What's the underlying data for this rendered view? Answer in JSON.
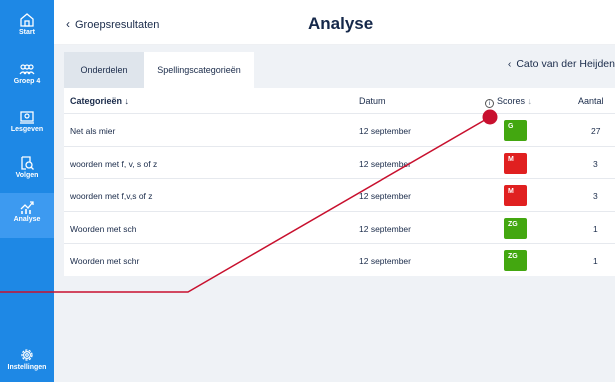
{
  "sidebar": {
    "items": [
      {
        "label": "Start",
        "icon": "home-icon"
      },
      {
        "label": "Groep 4",
        "icon": "group-icon"
      },
      {
        "label": "Lesgeven",
        "icon": "teach-icon"
      },
      {
        "label": "Volgen",
        "icon": "follow-icon"
      },
      {
        "label": "Analyse",
        "icon": "analysis-icon"
      },
      {
        "label": "Instellingen",
        "icon": "gear-icon"
      }
    ],
    "active": "Analyse"
  },
  "header": {
    "back_label": "Groepsresultaten",
    "title": "Analyse"
  },
  "tabs": [
    {
      "label": "Onderdelen",
      "active": false
    },
    {
      "label": "Spellingscategorieën",
      "active": true
    }
  ],
  "student_nav": {
    "label": "Cato van der Heijden"
  },
  "table": {
    "headers": {
      "category": "Categorieën",
      "date": "Datum",
      "scores": "Scores",
      "count": "Aantal"
    },
    "rows": [
      {
        "category": "Net als mier",
        "date": "12 september",
        "score": "G",
        "score_color": "#43a710",
        "count": "27"
      },
      {
        "category": "woorden met f, v, s of z",
        "date": "12 september",
        "score": "M",
        "score_color": "#e02020",
        "count": "3"
      },
      {
        "category": "woorden met f,v,s of z",
        "date": "12 september",
        "score": "M",
        "score_color": "#e02020",
        "count": "3"
      },
      {
        "category": "Woorden met sch",
        "date": "12 september",
        "score": "ZG",
        "score_color": "#43a710",
        "count": "1"
      },
      {
        "category": "Woorden met schr",
        "date": "12 september",
        "score": "ZG",
        "score_color": "#43a710",
        "count": "1"
      }
    ]
  },
  "colors": {
    "sidebar": "#1e88e5",
    "annotation": "#c8102e"
  }
}
